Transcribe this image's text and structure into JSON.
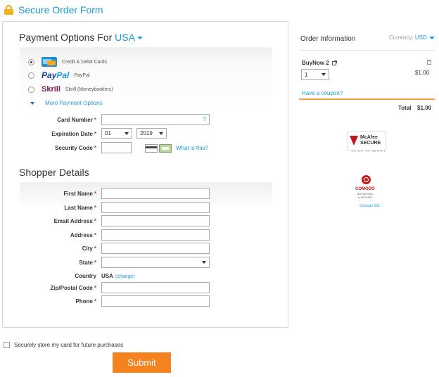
{
  "header": {
    "title": "Secure Order Form",
    "icon": "lock-icon"
  },
  "payment": {
    "title": "Payment Options For",
    "country": "USA",
    "options": [
      {
        "label": "Credit & Debit Cards",
        "selected": true,
        "icon": "credit-card-icon"
      },
      {
        "logo": "PayPal",
        "logo_part1": "Pay",
        "logo_part2": "Pal",
        "label": "PayPal",
        "selected": false
      },
      {
        "logo": "Skrill",
        "label": "Skrill (Moneybookers)",
        "selected": false
      }
    ],
    "more_label": "More Payment Options",
    "card_number_label": "Card Number",
    "card_number_help": "?",
    "expiration_label": "Expiration Date",
    "exp_month": "01",
    "exp_year": "2019",
    "security_label": "Security Code",
    "what_is_this": "What is this?"
  },
  "shopper": {
    "title": "Shopper Details",
    "first_name_label": "First Name",
    "last_name_label": "Last Name",
    "email_label": "Email Address",
    "address_label": "Address",
    "city_label": "City",
    "state_label": "State",
    "state_value": "",
    "country_label": "Country",
    "country_value": "USA",
    "country_change": "(change)",
    "zip_label": "Zip/Postal Code",
    "phone_label": "Phone",
    "required_mark": "*"
  },
  "footer": {
    "store_card_label": "Securely store my card for future purchases",
    "submit_label": "Submit"
  },
  "order": {
    "title": "Order Information",
    "currency_label": "Currency:",
    "currency_value": "USD",
    "product_name": "BuyNow 2",
    "quantity": "1",
    "price": "$1.00",
    "coupon_link": "Have a coupon?",
    "total_label": "Total",
    "total_value": "$1.00"
  },
  "badges": {
    "mcafee_name": "McAfee",
    "mcafee_secure": "SECURE",
    "mcafee_verify": "CLICK TO VERIFY",
    "comodo_name": "COMODO",
    "comodo_sub": "AUTHENTIC & SECURE",
    "comodo_ssl": "Comodo SSL"
  },
  "colors": {
    "accent": "#1a9bd7",
    "submit": "#f6821f",
    "required": "#e03232"
  }
}
